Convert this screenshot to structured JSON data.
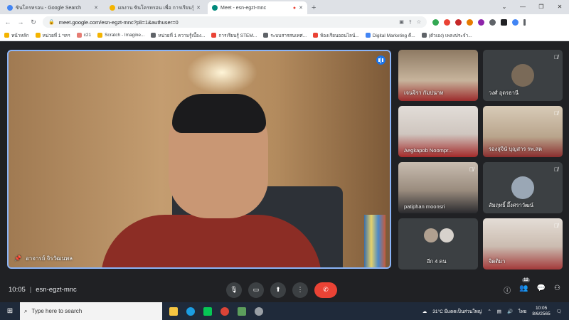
{
  "browser": {
    "tabs": [
      {
        "title": "ซินโครทรอน - Google Search",
        "active": false,
        "color": "#4285f4"
      },
      {
        "title": "ผลงาน ซินโครทรอน เพื่อ การเรียนรู้",
        "active": false,
        "color": "#f4b400"
      },
      {
        "title": "Meet - esn-egzt-mnc",
        "active": true,
        "color": "#00897b"
      }
    ],
    "new_tab": "+",
    "url": "meet.google.com/esn-egzt-mnc?pli=1&authuser=0",
    "bookmarks": [
      {
        "label": "หน้าหลัก",
        "color": "#f4b400"
      },
      {
        "label": "หน่วยที่ 1 ฯลฯ",
        "color": "#f4b400"
      },
      {
        "label": "c21",
        "color": "#e67c73"
      },
      {
        "label": "Scratch - Imagine...",
        "color": "#f4b400"
      },
      {
        "label": "หน่วยที่ 1 ความรู้เบื้อง...",
        "color": "#5f6368"
      },
      {
        "label": "การเรียนรู้ STEM...",
        "color": "#ea4335"
      },
      {
        "label": "ระบบสารสนเทศ...",
        "color": "#5f6368"
      },
      {
        "label": "ห้องเรียนออนไลน์...",
        "color": "#ea4335"
      },
      {
        "label": "Digital Marketing คื...",
        "color": "#4285f4"
      },
      {
        "label": "(ตัวเอง) เพลงประจำ...",
        "color": "#5f6368"
      }
    ]
  },
  "meet": {
    "main": {
      "name": "อาจารย์ จิรวัฒนพล"
    },
    "tiles": [
      {
        "name": "เจนจิรา กัมปนาท",
        "muted": false,
        "type": "camera",
        "bg": "#b89a80"
      },
      {
        "name": "วงศ์ อุดรธานี",
        "muted": true,
        "type": "avatar",
        "bg": "#3c4043"
      },
      {
        "name": "Aegkapob Noompr...",
        "muted": false,
        "type": "camera",
        "bg": "#d9d3cf"
      },
      {
        "name": "รองสุจินั บุญสาร รพ.สต",
        "muted": true,
        "type": "camera",
        "bg": "#c7b9a6"
      },
      {
        "name": "patiphan moonsri",
        "muted": true,
        "type": "camera",
        "bg": "#b5a79a"
      },
      {
        "name": "สัมฤทธิ์ อึ้งศราวัฒน์",
        "muted": true,
        "type": "avatar",
        "bg": "#3c4043"
      },
      {
        "name": "อีก 4 คน",
        "muted": false,
        "type": "others",
        "bg": "#3c4043"
      },
      {
        "name": "จิตติมา",
        "muted": true,
        "type": "camera",
        "bg": "#d8cfc8"
      }
    ],
    "time": "10:05",
    "meeting_code": "esn-egzt-mnc",
    "participant_count": "12"
  },
  "taskbar": {
    "search_placeholder": "Type here to search",
    "weather": "31°C มีแดดเป็นส่วนใหญ่",
    "lang": "ไทย",
    "time": "10:05",
    "date": "8/6/2565"
  }
}
